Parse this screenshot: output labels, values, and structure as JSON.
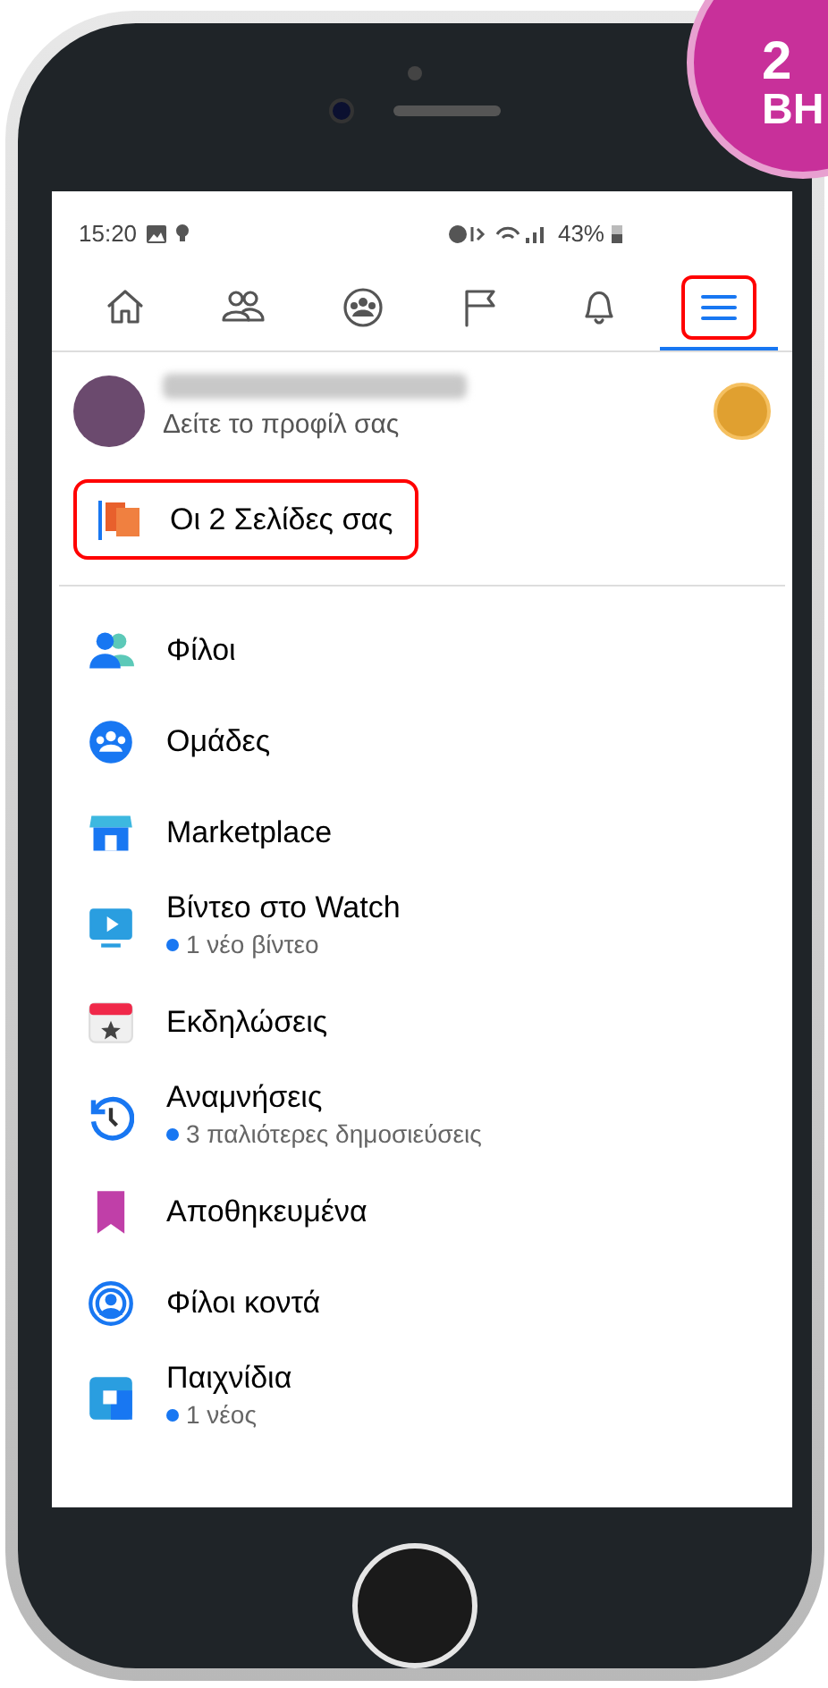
{
  "step_badge": {
    "number": "2",
    "text": "ΒΗ"
  },
  "status_bar": {
    "time": "15:20",
    "battery": "43%"
  },
  "tabs": [
    {
      "selected": false,
      "highlighted": false
    },
    {
      "selected": false,
      "highlighted": false
    },
    {
      "selected": false,
      "highlighted": false
    },
    {
      "selected": false,
      "highlighted": false
    },
    {
      "selected": false,
      "highlighted": false
    },
    {
      "selected": true,
      "highlighted": true
    }
  ],
  "profile": {
    "subtitle": "Δείτε το προφίλ σας"
  },
  "pages_link": {
    "label": "Οι 2 Σελίδες σας",
    "highlighted": true
  },
  "menu_items": [
    {
      "label": "Φίλοι"
    },
    {
      "label": "Ομάδες"
    },
    {
      "label": "Marketplace"
    },
    {
      "label": "Βίντεο στο Watch",
      "note": "1 νέο βίντεο"
    },
    {
      "label": "Εκδηλώσεις"
    },
    {
      "label": "Αναμνήσεις",
      "note": "3 παλιότερες δημοσιεύσεις"
    },
    {
      "label": "Αποθηκευμένα"
    },
    {
      "label": "Φίλοι κοντά"
    },
    {
      "label": "Παιχνίδια",
      "note": "1 νέος"
    }
  ]
}
